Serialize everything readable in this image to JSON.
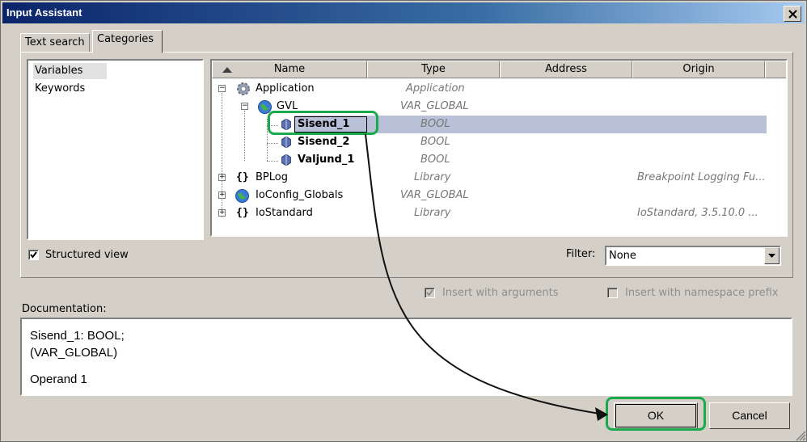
{
  "window": {
    "title": "Input Assistant"
  },
  "tabs": [
    {
      "label": "Text search"
    },
    {
      "label": "Categories"
    }
  ],
  "categories": [
    {
      "label": "Variables",
      "selected": true
    },
    {
      "label": "Keywords"
    }
  ],
  "tree": {
    "columns": {
      "name": "Name",
      "type": "Type",
      "address": "Address",
      "origin": "Origin"
    },
    "rows": [
      {
        "name": "Application",
        "type": "Application",
        "origin": "",
        "icon": "gear-icon",
        "expanded": true
      },
      {
        "name": "GVL",
        "type": "VAR_GLOBAL",
        "origin": "",
        "icon": "globe-icon",
        "expanded": true
      },
      {
        "name": "Sisend_1",
        "type": "BOOL",
        "origin": "",
        "icon": "variable-icon",
        "selected": true
      },
      {
        "name": "Sisend_2",
        "type": "BOOL",
        "origin": "",
        "icon": "variable-icon"
      },
      {
        "name": "Valjund_1",
        "type": "BOOL",
        "origin": "",
        "icon": "variable-icon"
      },
      {
        "name": "BPLog",
        "type": "Library",
        "origin": "Breakpoint Logging Fu...",
        "icon": "braces-icon",
        "expanded": false
      },
      {
        "name": "IoConfig_Globals",
        "type": "VAR_GLOBAL",
        "origin": "",
        "icon": "globe-icon",
        "expanded": false
      },
      {
        "name": "IoStandard",
        "type": "Library",
        "origin": "IoStandard, 3.5.10.0 ...",
        "icon": "braces-icon",
        "expanded": false
      }
    ]
  },
  "options": {
    "structured_view": {
      "label": "Structured view",
      "checked": true
    },
    "filter": {
      "label": "Filter:",
      "value": "None"
    },
    "insert_with_arguments": {
      "label": "Insert with arguments",
      "checked": true,
      "enabled": false
    },
    "insert_with_namespace_prefix": {
      "label": "Insert with namespace prefix",
      "checked": false,
      "enabled": false
    }
  },
  "documentation": {
    "label": "Documentation:",
    "lines": [
      "Sisend_1: BOOL;",
      "(VAR_GLOBAL)",
      "Operand 1"
    ]
  },
  "buttons": {
    "ok": "OK",
    "cancel": "Cancel"
  },
  "colors": {
    "highlight": "#1aa94c",
    "title_bar": "#0a246a",
    "selection": "#b9c1d8"
  }
}
